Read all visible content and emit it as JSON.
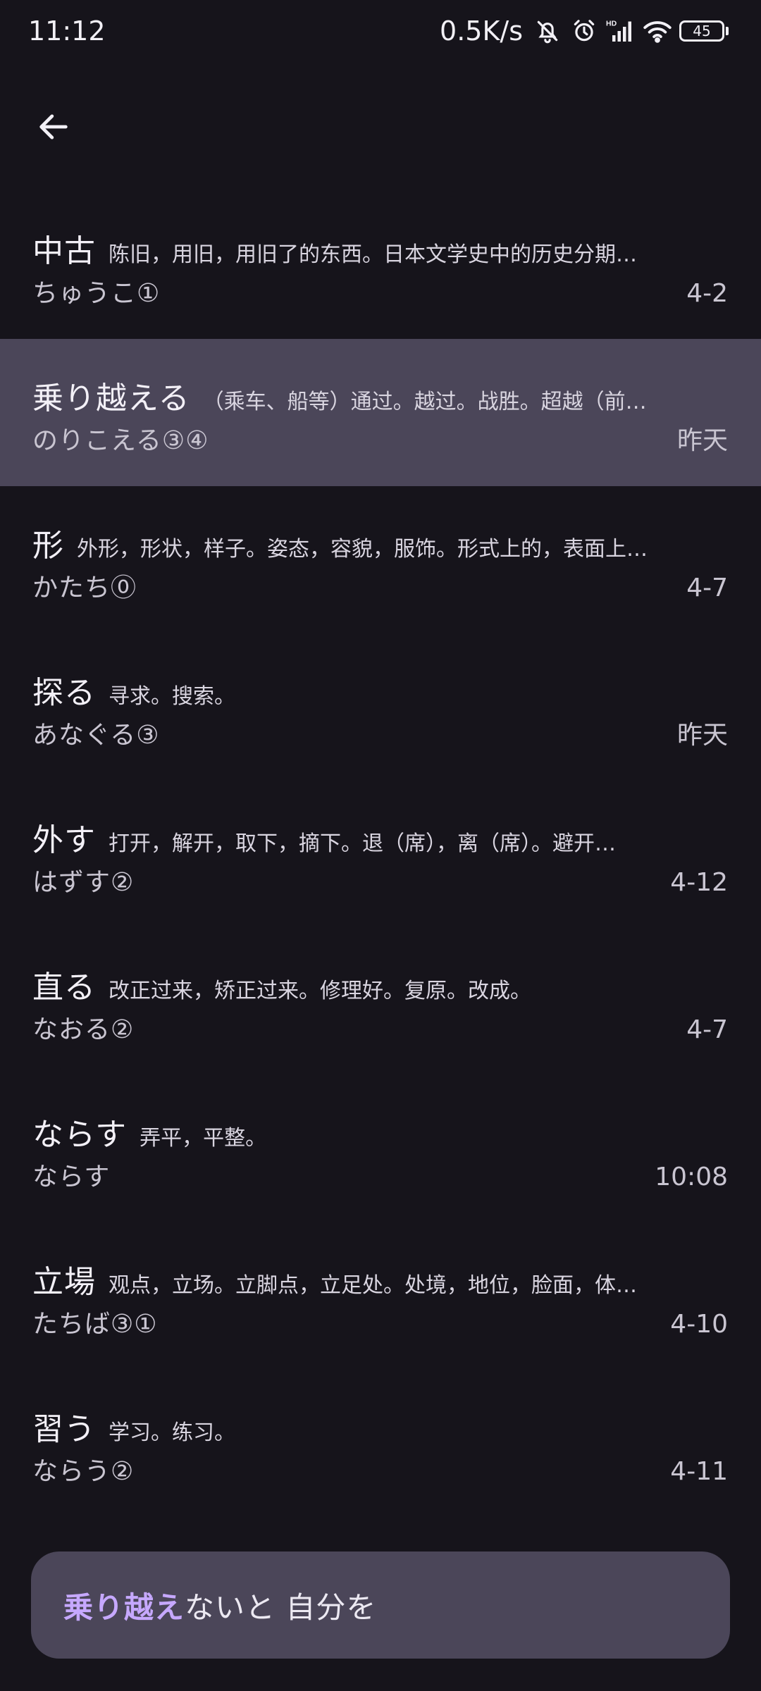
{
  "status_bar": {
    "time": "11:12",
    "net_speed": "0.5K/s",
    "icons": [
      "bell-off-icon",
      "alarm-icon",
      "signal-hd-icon",
      "wifi-icon"
    ],
    "battery": "45"
  },
  "app_bar": {
    "back_icon": "arrow-left-icon"
  },
  "words": [
    {
      "term": "中古",
      "meaning": "陈旧，用旧，用旧了的东西。日本文学史中的历史分期…",
      "reading": "ちゅうこ①",
      "date": "4-2",
      "selected": false
    },
    {
      "term": "乗り越える",
      "meaning": "（乘车、船等）通过。越过。战胜。超越（前…",
      "reading": "のりこえる③④",
      "date": "昨天",
      "selected": true
    },
    {
      "term": "形",
      "meaning": "外形，形状，样子。姿态，容貌，服饰。形式上的，表面上…",
      "reading": "かたち⓪",
      "date": "4-7",
      "selected": false
    },
    {
      "term": "探る",
      "meaning": "寻求。搜索。",
      "reading": "あなぐる③",
      "date": "昨天",
      "selected": false
    },
    {
      "term": "外す",
      "meaning": "打开，解开，取下，摘下。退（席），离（席）。避开…",
      "reading": "はずす②",
      "date": "4-12",
      "selected": false
    },
    {
      "term": "直る",
      "meaning": "改正过来，矫正过来。修理好。复原。改成。",
      "reading": "なおる②",
      "date": "4-7",
      "selected": false
    },
    {
      "term": "ならす",
      "meaning": "弄平，平整。",
      "reading": "ならす",
      "date": "10:08",
      "selected": false
    },
    {
      "term": "立場",
      "meaning": "观点，立场。立脚点，立足处。处境，地位，脸面，体…",
      "reading": "たちば③①",
      "date": "4-10",
      "selected": false
    },
    {
      "term": "習う",
      "meaning": "学习。练习。",
      "reading": "ならう②",
      "date": "4-11",
      "selected": false
    }
  ],
  "example_card": {
    "highlight": "乗り越え",
    "rest": "ないと 自分を"
  },
  "colors": {
    "background": "#16141b",
    "selected_row": "#4b4659",
    "card": "#4b4659",
    "highlight": "#c6a8ff"
  }
}
